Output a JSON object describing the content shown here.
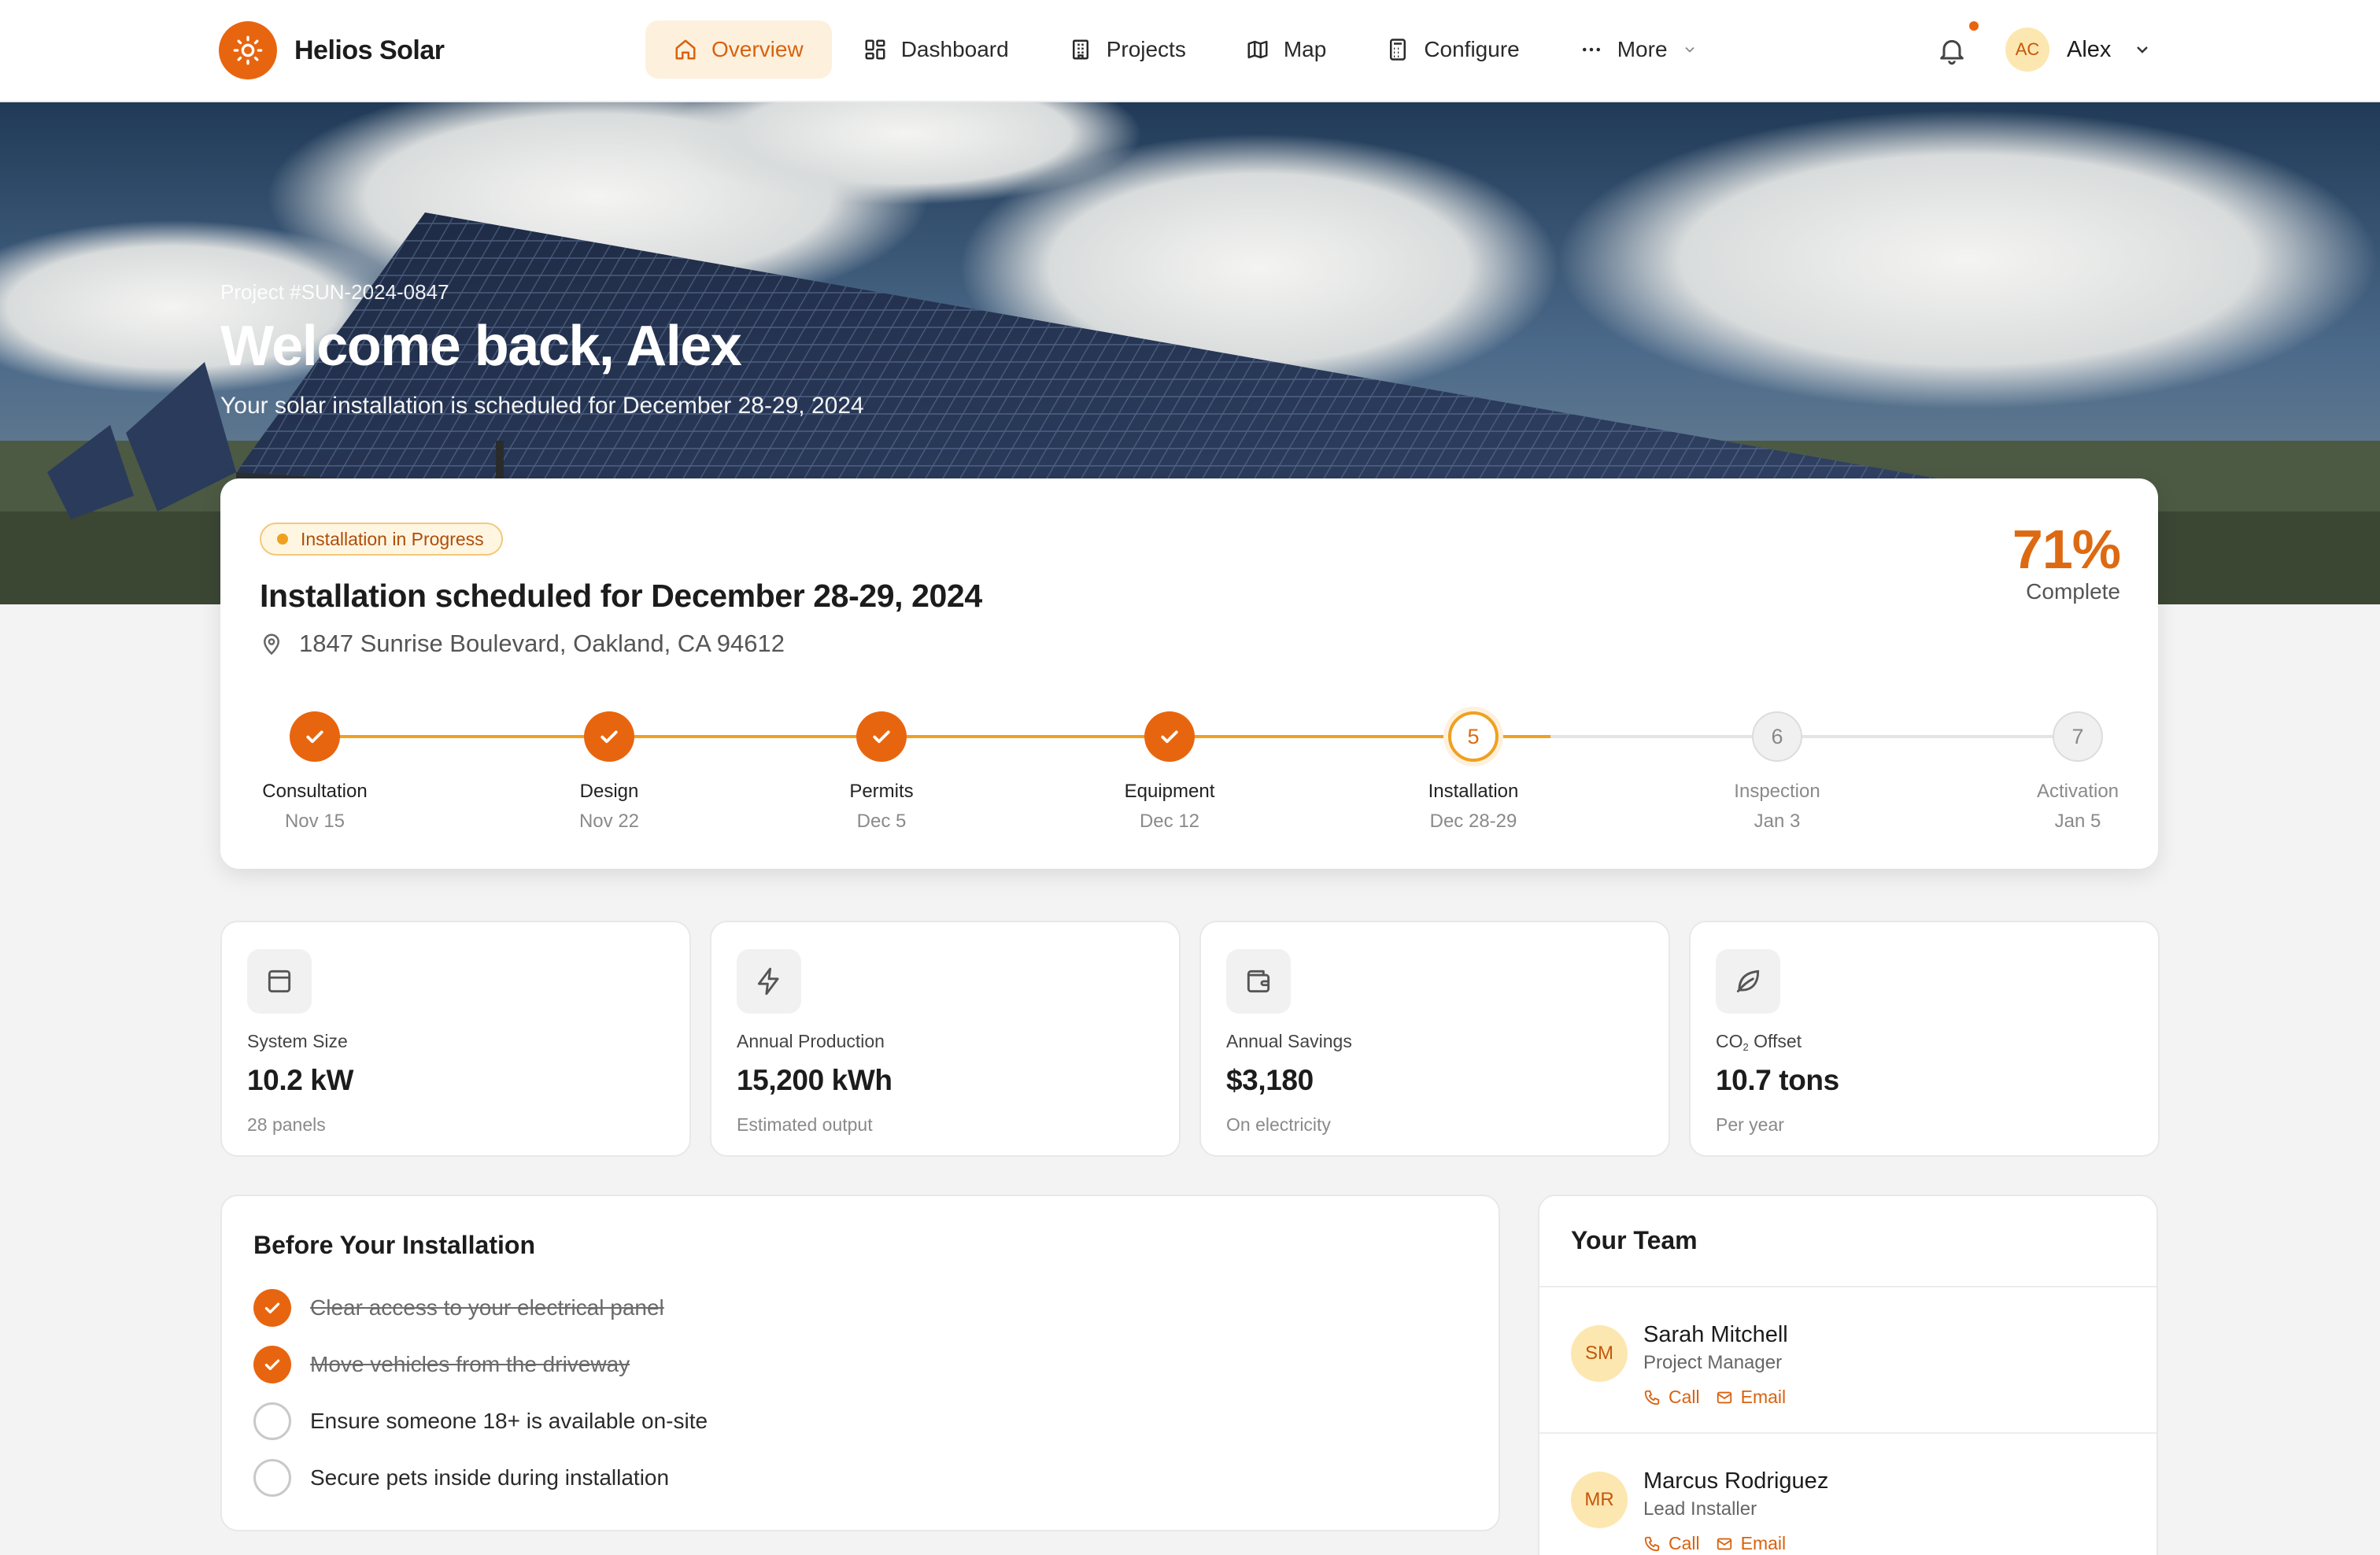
{
  "brand": {
    "name": "Helios Solar",
    "accent": "#e8650f"
  },
  "nav": {
    "items": [
      {
        "label": "Overview",
        "icon": "home-icon",
        "active": true
      },
      {
        "label": "Dashboard",
        "icon": "grid-icon"
      },
      {
        "label": "Projects",
        "icon": "building-icon"
      },
      {
        "label": "Map",
        "icon": "map-icon"
      },
      {
        "label": "Configure",
        "icon": "calculator-icon"
      },
      {
        "label": "More",
        "icon": "ellipsis-icon"
      }
    ]
  },
  "user": {
    "initials": "AC",
    "name": "Alex"
  },
  "hero": {
    "project_id": "Project #SUN-2024-0847",
    "title": "Welcome back, Alex",
    "subtitle": "Your solar installation is scheduled for December 28-29, 2024"
  },
  "status": {
    "badge": "Installation in Progress",
    "title": "Installation scheduled for December 28-29, 2024",
    "address": "1847 Sunrise Boulevard, Oakland, CA 94612",
    "percent": "71%",
    "percent_label": "Complete",
    "progress_fraction": 0.71
  },
  "timeline": [
    {
      "num": "1",
      "label": "Consultation",
      "date": "Nov 15",
      "state": "done"
    },
    {
      "num": "2",
      "label": "Design",
      "date": "Nov 22",
      "state": "done"
    },
    {
      "num": "3",
      "label": "Permits",
      "date": "Dec 5",
      "state": "done"
    },
    {
      "num": "4",
      "label": "Equipment",
      "date": "Dec 12",
      "state": "done"
    },
    {
      "num": "5",
      "label": "Installation",
      "date": "Dec 28-29",
      "state": "current"
    },
    {
      "num": "6",
      "label": "Inspection",
      "date": "Jan 3",
      "state": "todo"
    },
    {
      "num": "7",
      "label": "Activation",
      "date": "Jan 5",
      "state": "todo"
    }
  ],
  "stats": [
    {
      "label": "System Size",
      "value": "10.2 kW",
      "note": "28 panels",
      "icon": "panel-icon"
    },
    {
      "label": "Annual Production",
      "value": "15,200 kWh",
      "note": "Estimated output",
      "icon": "lightning-icon"
    },
    {
      "label": "Annual Savings",
      "value": "$3,180",
      "note": "On electricity",
      "icon": "wallet-icon"
    },
    {
      "label_main": "CO",
      "label_sub": "2",
      "label_tail": " Offset",
      "value": "10.7 tons",
      "note": "Per year",
      "icon": "leaf-icon"
    }
  ],
  "checklist": {
    "title": "Before Your Installation",
    "items": [
      {
        "text": "Clear access to your electrical panel",
        "done": true
      },
      {
        "text": "Move vehicles from the driveway",
        "done": true
      },
      {
        "text": "Ensure someone 18+ is available on-site",
        "done": false
      },
      {
        "text": "Secure pets inside during installation",
        "done": false
      }
    ]
  },
  "team": {
    "title": "Your Team",
    "call_label": "Call",
    "email_label": "Email",
    "members": [
      {
        "initials": "SM",
        "name": "Sarah Mitchell",
        "role": "Project Manager"
      },
      {
        "initials": "MR",
        "name": "Marcus Rodriguez",
        "role": "Lead Installer"
      }
    ]
  }
}
